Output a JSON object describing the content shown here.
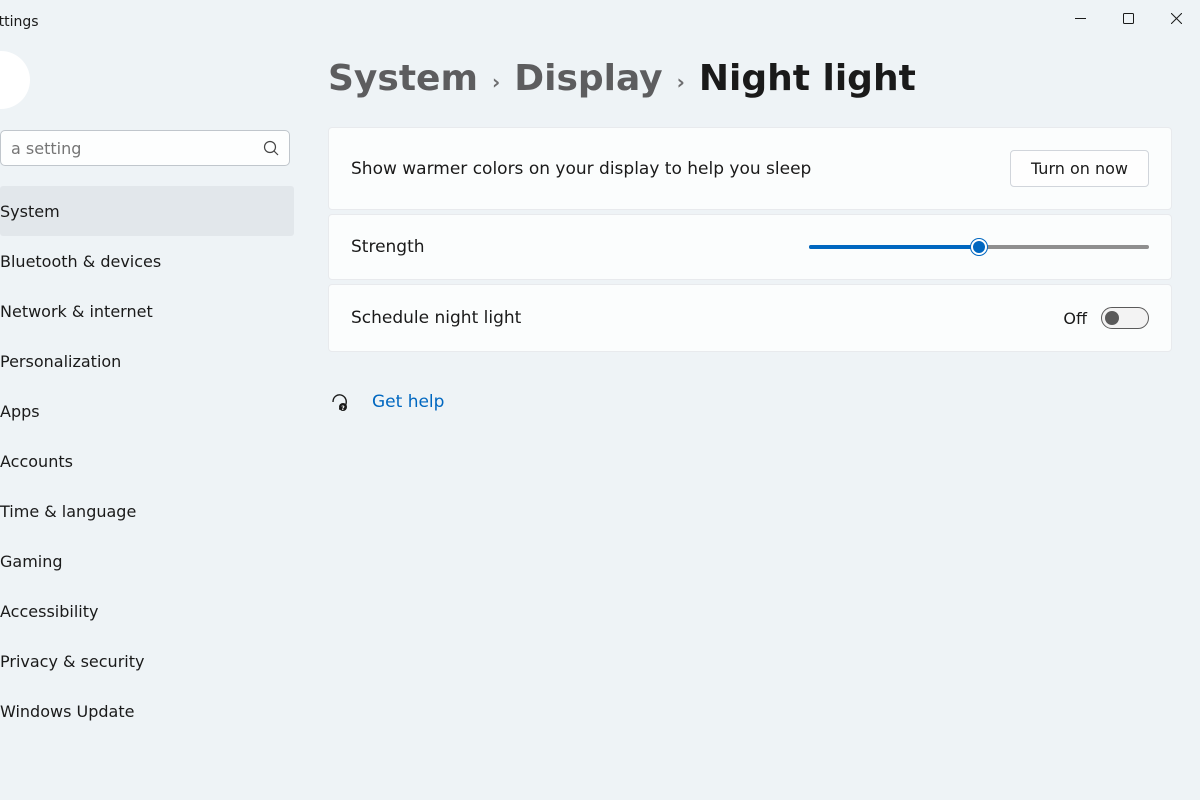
{
  "window": {
    "title": "ettings"
  },
  "search": {
    "placeholder": "a setting"
  },
  "sidebar": {
    "items": [
      {
        "label": "System",
        "active": true
      },
      {
        "label": "Bluetooth & devices",
        "active": false
      },
      {
        "label": "Network & internet",
        "active": false
      },
      {
        "label": "Personalization",
        "active": false
      },
      {
        "label": "Apps",
        "active": false
      },
      {
        "label": "Accounts",
        "active": false
      },
      {
        "label": "Time & language",
        "active": false
      },
      {
        "label": "Gaming",
        "active": false
      },
      {
        "label": "Accessibility",
        "active": false
      },
      {
        "label": "Privacy & security",
        "active": false
      },
      {
        "label": "Windows Update",
        "active": false
      }
    ]
  },
  "breadcrumb": {
    "level1": "System",
    "level2": "Display",
    "current": "Night light"
  },
  "cards": {
    "description": "Show warmer colors on your display to help you sleep",
    "turn_on_button": "Turn on now",
    "strength_label": "Strength",
    "strength_value_percent": 50,
    "schedule_label": "Schedule night light",
    "schedule_state": "Off"
  },
  "help": {
    "label": "Get help"
  }
}
